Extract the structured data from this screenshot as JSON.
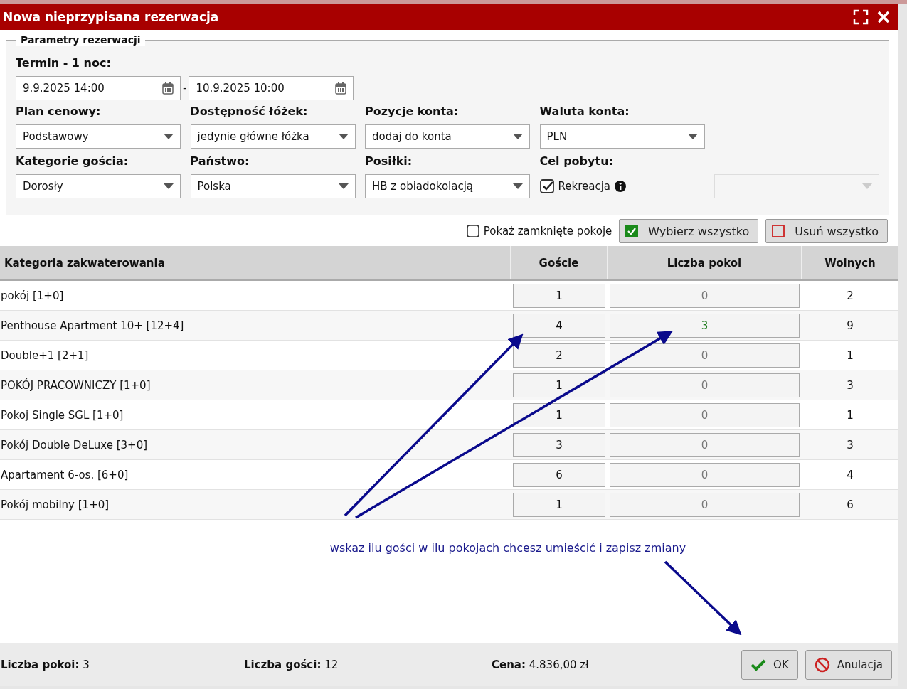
{
  "window": {
    "title": "Nowa nieprzypisana rezerwacja"
  },
  "fieldset": {
    "legend": "Parametry rezerwacji",
    "term_label": "Termin - 1 noc:",
    "date_from": "9.9.2025 14:00",
    "date_separator": "-",
    "date_to": "10.9.2025 10:00",
    "fields": [
      {
        "kind": "select",
        "label": "Plan cenowy:",
        "value": "Podstawowy"
      },
      {
        "kind": "select",
        "label": "Dostępność łóżek:",
        "value": "jedynie główne łóżka"
      },
      {
        "kind": "select",
        "label": "Pozycje konta:",
        "value": "dodaj do konta"
      },
      {
        "kind": "select",
        "label": "Waluta konta:",
        "value": "PLN"
      },
      {
        "kind": "select",
        "label": "Kategorie gościa:",
        "value": "Dorosły"
      },
      {
        "kind": "select",
        "label": "Państwo:",
        "value": "Polska"
      },
      {
        "kind": "select",
        "label": "Posiłki:",
        "value": "HB z obiadokolacją"
      },
      {
        "kind": "checkbox",
        "label": "Cel pobytu:",
        "value": "Rekreacja",
        "checked": true,
        "disabled_select": true
      }
    ]
  },
  "options": {
    "show_closed": {
      "label": "Pokaż zamknięte pokoje",
      "checked": false
    },
    "buttons": [
      {
        "kind": "select_all",
        "label": "Wybierz wszystko"
      },
      {
        "kind": "remove_all",
        "label": "Usuń wszystko"
      }
    ]
  },
  "table": {
    "columns": [
      "Kategoria zakwaterowania",
      "Goście",
      "Liczba pokoi",
      "Wolnych"
    ],
    "rows": [
      {
        "name": "pokój [1+0]",
        "guests": "1",
        "rooms": "0",
        "free": "2",
        "selected": false
      },
      {
        "name": "Penthouse Apartment 10+ [12+4]",
        "guests": "4",
        "rooms": "3",
        "free": "9",
        "selected": true
      },
      {
        "name": "Double+1 [2+1]",
        "guests": "2",
        "rooms": "0",
        "free": "1",
        "selected": false
      },
      {
        "name": "POKÓJ PRACOWNICZY [1+0]",
        "guests": "1",
        "rooms": "0",
        "free": "3",
        "selected": false
      },
      {
        "name": "Pokoj Single SGL [1+0]",
        "guests": "1",
        "rooms": "0",
        "free": "1",
        "selected": false
      },
      {
        "name": "Pokój Double DeLuxe [3+0]",
        "guests": "3",
        "rooms": "0",
        "free": "3",
        "selected": false
      },
      {
        "name": "Apartament 6-os. [6+0]",
        "guests": "6",
        "rooms": "0",
        "free": "4",
        "selected": false
      },
      {
        "name": "Pokój mobilny [1+0]",
        "guests": "1",
        "rooms": "0",
        "free": "6",
        "selected": false
      }
    ]
  },
  "annotation": "wskaz ilu gości w ilu pokojach chcesz umieścić i zapisz zmiany",
  "footer": {
    "stats": [
      {
        "label": "Liczba pokoi:",
        "value": "3"
      },
      {
        "label": "Liczba gości:",
        "value": "12"
      },
      {
        "label": "Cena:",
        "value": "4.836,00 zł"
      }
    ],
    "buttons": [
      {
        "kind": "ok",
        "label": "OK"
      },
      {
        "kind": "cancel",
        "label": "Anulacja"
      }
    ]
  }
}
